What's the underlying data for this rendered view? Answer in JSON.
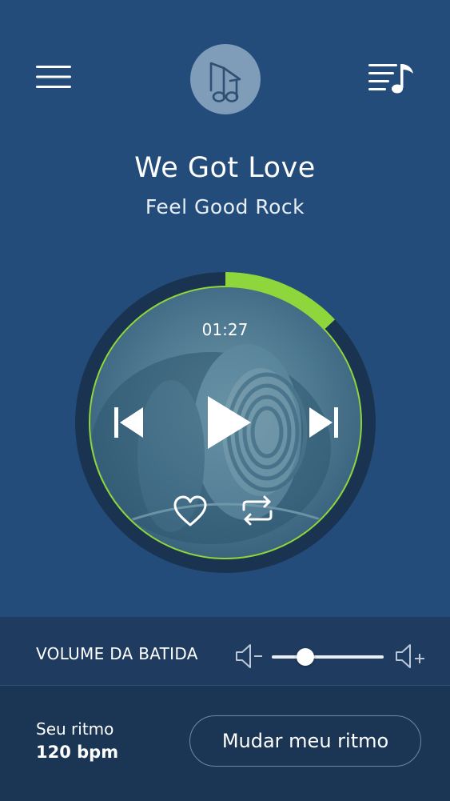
{
  "header": {
    "menu_icon": "hamburger-menu-icon",
    "logo_icon": "music-note-icon",
    "playlist_icon": "playlist-music-icon"
  },
  "song": {
    "title": "We Got Love",
    "subtitle": "Feel Good Rock"
  },
  "player": {
    "elapsed": "01:27",
    "progress": 0.13,
    "accent_color": "#8ed63b",
    "ring_color": "#1a3350",
    "controls": {
      "previous_icon": "skip-previous-icon",
      "play_icon": "play-icon",
      "next_icon": "skip-next-icon",
      "favorite_icon": "heart-outline-icon",
      "repeat_icon": "repeat-icon"
    }
  },
  "volume": {
    "label": "VOLUME DA BATIDA",
    "level": 0.24,
    "minus_icon": "volume-down-icon",
    "plus_icon": "volume-up-icon"
  },
  "rhythm": {
    "label": "Seu ritmo",
    "value": "120 bpm",
    "button_label": "Mudar meu ritmo"
  },
  "colors": {
    "background": "#234c7a",
    "volume_panel": "#1f3c60",
    "bottom_panel": "#1b3554"
  }
}
